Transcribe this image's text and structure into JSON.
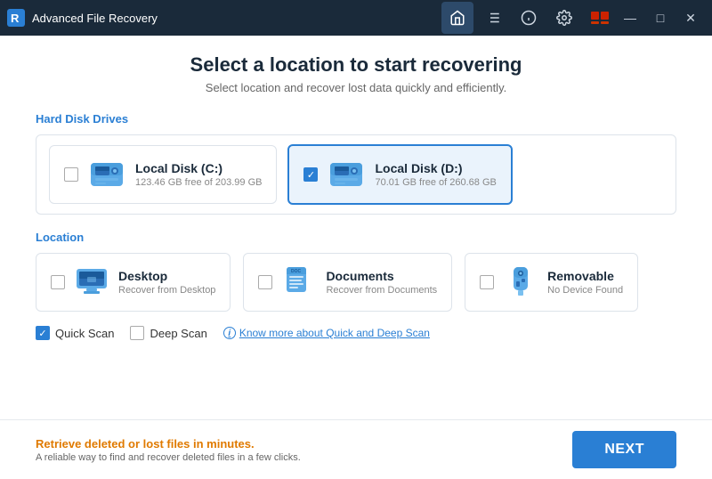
{
  "titleBar": {
    "appName": "Advanced File Recovery",
    "navIcons": [
      "home",
      "list",
      "info",
      "settings"
    ],
    "controls": [
      "network",
      "minimize",
      "maximize",
      "close"
    ]
  },
  "page": {
    "title": "Select a location to start recovering",
    "subtitle": "Select location and recover lost data quickly and efficiently."
  },
  "sections": {
    "hardDiskDrives": {
      "label": "Hard Disk Drives",
      "drives": [
        {
          "name": "Local Disk (C:)",
          "space": "123.46 GB free of 203.99 GB",
          "selected": false
        },
        {
          "name": "Local Disk (D:)",
          "space": "70.01 GB free of 260.68 GB",
          "selected": true
        }
      ]
    },
    "location": {
      "label": "Location",
      "items": [
        {
          "name": "Desktop",
          "sub": "Recover from Desktop",
          "selected": false,
          "icon": "desktop"
        },
        {
          "name": "Documents",
          "sub": "Recover from Documents",
          "selected": false,
          "icon": "documents"
        },
        {
          "name": "Removable",
          "sub": "No Device Found",
          "selected": false,
          "icon": "usb"
        }
      ]
    },
    "scanOptions": {
      "quickScan": {
        "label": "Quick Scan",
        "checked": true
      },
      "deepScan": {
        "label": "Deep Scan",
        "checked": false
      },
      "learnMore": "Know more about Quick and Deep Scan"
    }
  },
  "footer": {
    "msgTitle": "Retrieve deleted or lost files in minutes.",
    "msgSub": "A reliable way to find and recover deleted files in a few clicks.",
    "nextBtn": "NEXT"
  }
}
